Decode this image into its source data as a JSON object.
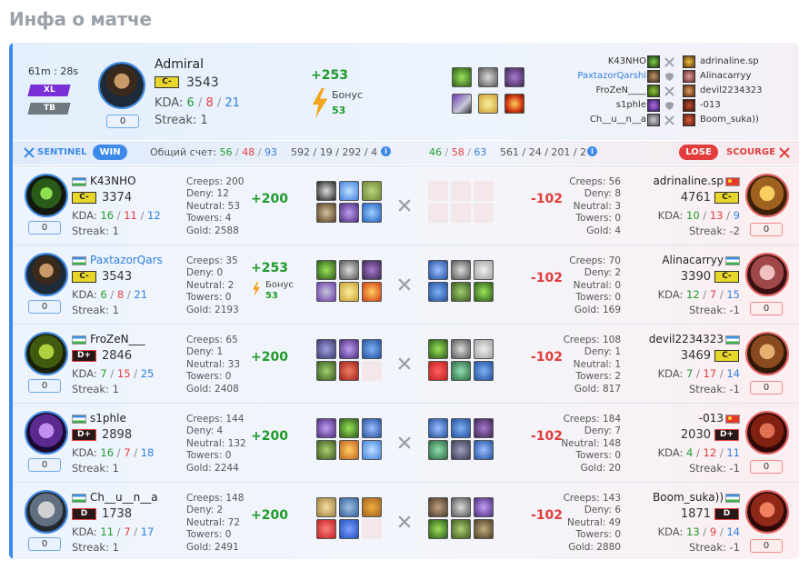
{
  "page_title": "Инфа о матче",
  "match": {
    "duration": "61m : 28s",
    "mode_badge": "XL",
    "type_badge": "TB"
  },
  "player": {
    "name": "Admiral",
    "rank": "C-",
    "mmr": "3543",
    "kda_label": "KDA:",
    "kills": "6",
    "deaths": "8",
    "assists": "21",
    "streak": "Streak: 1",
    "count": "0",
    "delta": "+253",
    "bonus_label": "Бонус",
    "bonus_value": "53"
  },
  "matchups": [
    {
      "left": "K43NHO",
      "right": "adrinaline.sp"
    },
    {
      "left": "PaxtazorQarshi",
      "right": "Alinacarryy"
    },
    {
      "left": "FroZeN____",
      "right": "devil2234323"
    },
    {
      "left": "s1phle",
      "right": "-013"
    },
    {
      "left": "Ch__u__n__a",
      "right": "Boom_suka))"
    }
  ],
  "summary": {
    "sentinel_label": "SENTINEL",
    "win_label": "WIN",
    "score_label": "Общий счет:",
    "s_kills": "56",
    "s_deaths": "48",
    "s_assists": "93",
    "s_totals": "592 / 19 / 292 / 4",
    "r_kills": "46",
    "r_deaths": "58",
    "r_assists": "63",
    "r_totals": "561 / 24 / 201 / 2",
    "lose_label": "LOSE",
    "scourge_label": "SCOURGE"
  },
  "labels": {
    "creeps": "Creeps:",
    "deny": "Deny:",
    "neutral": "Neutral:",
    "towers": "Towers:",
    "gold": "Gold:",
    "kda": "KDA:",
    "bonus": "Бонус"
  },
  "rows": [
    {
      "left": {
        "name": "K43NHO",
        "name_link": false,
        "rank": "C-",
        "rank_type": "c",
        "mmr": "3374",
        "k": "16",
        "d": "11",
        "a": "12",
        "streak": "Streak: 1",
        "count": "0",
        "creeps": "200",
        "deny": "12",
        "neutral": "53",
        "towers": "4",
        "gold": "2588",
        "delta": "+200",
        "bonus": ""
      },
      "right": {
        "name": "adrinaline.sp",
        "rank": "C-",
        "rank_type": "c",
        "mmr": "4761",
        "k": "10",
        "d": "13",
        "a": "9",
        "streak": "Streak: -2",
        "count": "0",
        "creeps": "56",
        "deny": "8",
        "neutral": "3",
        "towers": "0",
        "gold": "4",
        "delta": "-102"
      }
    },
    {
      "left": {
        "name": "PaxtazorQars",
        "name_link": true,
        "rank": "C-",
        "rank_type": "c",
        "mmr": "3543",
        "k": "6",
        "d": "8",
        "a": "21",
        "streak": "Streak: 1",
        "count": "0",
        "creeps": "35",
        "deny": "0",
        "neutral": "2",
        "towers": "0",
        "gold": "2193",
        "delta": "+253",
        "bonus": "53"
      },
      "right": {
        "name": "Alinacarryy",
        "rank": "C-",
        "rank_type": "c",
        "mmr": "3390",
        "k": "12",
        "d": "7",
        "a": "15",
        "streak": "Streak: -1",
        "count": "0",
        "creeps": "70",
        "deny": "2",
        "neutral": "0",
        "towers": "0",
        "gold": "169",
        "delta": "-102"
      }
    },
    {
      "left": {
        "name": "FroZeN___",
        "name_link": false,
        "rank": "D+",
        "rank_type": "d",
        "mmr": "2846",
        "k": "7",
        "d": "15",
        "a": "25",
        "streak": "Streak: 1",
        "count": "0",
        "creeps": "65",
        "deny": "1",
        "neutral": "33",
        "towers": "0",
        "gold": "2408",
        "delta": "+200",
        "bonus": ""
      },
      "right": {
        "name": "devil2234323",
        "rank": "C-",
        "rank_type": "c",
        "mmr": "3469",
        "k": "7",
        "d": "17",
        "a": "14",
        "streak": "Streak: -1",
        "count": "0",
        "creeps": "108",
        "deny": "1",
        "neutral": "1",
        "towers": "2",
        "gold": "817",
        "delta": "-102"
      }
    },
    {
      "left": {
        "name": "s1phle",
        "name_link": false,
        "rank": "D+",
        "rank_type": "d",
        "mmr": "2898",
        "k": "16",
        "d": "7",
        "a": "18",
        "streak": "Streak: 1",
        "count": "0",
        "creeps": "144",
        "deny": "4",
        "neutral": "132",
        "towers": "0",
        "gold": "2244",
        "delta": "+200",
        "bonus": ""
      },
      "right": {
        "name": "-013",
        "rank": "D+",
        "rank_type": "d",
        "mmr": "2030",
        "k": "4",
        "d": "12",
        "a": "11",
        "streak": "Streak: -1",
        "count": "0",
        "creeps": "184",
        "deny": "7",
        "neutral": "148",
        "towers": "0",
        "gold": "20",
        "delta": "-102"
      }
    },
    {
      "left": {
        "name": "Ch__u__n__a",
        "name_link": false,
        "rank": "D",
        "rank_type": "d",
        "mmr": "1738",
        "k": "11",
        "d": "7",
        "a": "17",
        "streak": "Streak: 1",
        "count": "0",
        "creeps": "148",
        "deny": "2",
        "neutral": "72",
        "towers": "0",
        "gold": "2491",
        "delta": "+200",
        "bonus": ""
      },
      "right": {
        "name": "Boom_suka))",
        "rank": "D",
        "rank_type": "d",
        "mmr": "1871",
        "k": "13",
        "d": "9",
        "a": "14",
        "streak": "Streak: -1",
        "count": "0",
        "creeps": "143",
        "deny": "6",
        "neutral": "49",
        "towers": "0",
        "gold": "2880",
        "delta": "-102"
      }
    }
  ],
  "icons": {
    "close": "close-icon",
    "shield": "shield-icon",
    "crossed_swords": "crossed-swords-icon",
    "info": "info-icon",
    "bolt": "lightning-bolt-icon",
    "flag_uz": "flag-uzbekistan-icon",
    "flag_cn": "flag-china-icon"
  },
  "colors": {
    "accent": "#3d8ae8",
    "win": "#1f9a2a",
    "lose": "#e23c3c",
    "badge_xl": "#7a2fd6"
  }
}
